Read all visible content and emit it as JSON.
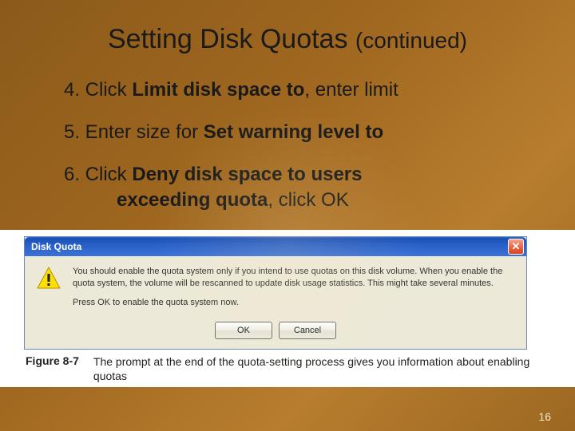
{
  "title": {
    "main": "Setting Disk Quotas",
    "continued": "(continued)"
  },
  "steps": [
    {
      "num": "4.",
      "pre": " Click ",
      "bold": "Limit disk space to",
      "post": ", enter limit"
    },
    {
      "num": "5.",
      "pre": " Enter size for ",
      "bold": "Set warning level to",
      "post": ""
    },
    {
      "num": "6.",
      "pre": " Click ",
      "bold": "Deny disk space to users",
      "bold2": "exceeding quota",
      "post": ", click OK"
    }
  ],
  "dialog": {
    "title": "Disk Quota",
    "msg1": "You should enable the quota system only if you intend to use quotas on this disk volume. When you enable the quota system, the volume will be rescanned to update disk usage statistics. This might take several minutes.",
    "msg2": "Press OK to enable the quota system now.",
    "ok": "OK",
    "cancel": "Cancel"
  },
  "caption": {
    "figure": "Figure 8-7",
    "text": "The prompt at the end of the quota-setting process gives you information about enabling quotas"
  },
  "page": "16"
}
